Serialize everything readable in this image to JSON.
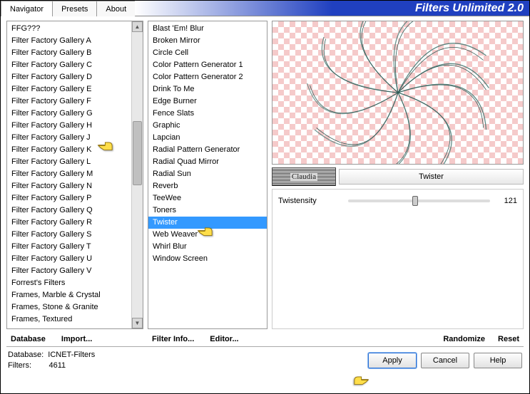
{
  "app_title": "Filters Unlimited 2.0",
  "tabs": [
    {
      "label": "Navigator",
      "active": true
    },
    {
      "label": "Presets",
      "active": false
    },
    {
      "label": "About",
      "active": false
    }
  ],
  "categories": [
    "FFG???",
    "Filter Factory Gallery A",
    "Filter Factory Gallery B",
    "Filter Factory Gallery C",
    "Filter Factory Gallery D",
    "Filter Factory Gallery E",
    "Filter Factory Gallery F",
    "Filter Factory Gallery G",
    "Filter Factory Gallery H",
    "Filter Factory Gallery J",
    "Filter Factory Gallery K",
    "Filter Factory Gallery L",
    "Filter Factory Gallery M",
    "Filter Factory Gallery N",
    "Filter Factory Gallery P",
    "Filter Factory Gallery Q",
    "Filter Factory Gallery R",
    "Filter Factory Gallery S",
    "Filter Factory Gallery T",
    "Filter Factory Gallery U",
    "Filter Factory Gallery V",
    "Forrest's Filters",
    "Frames, Marble & Crystal",
    "Frames, Stone & Granite",
    "Frames, Textured"
  ],
  "category_selected_index": 9,
  "filters": [
    "Blast 'Em! Blur",
    "Broken Mirror",
    "Circle Cell",
    "Color Pattern Generator 1",
    "Color Pattern Generator 2",
    "Drink To Me",
    "Edge Burner",
    "Fence Slats",
    "Graphic",
    "Lapcian",
    "Radial Pattern Generator",
    "Radial Quad Mirror",
    "Radial Sun",
    "Reverb",
    "TeeWee",
    "Toners",
    "Twister",
    "Web Weaver",
    "Whirl Blur",
    "Window Screen"
  ],
  "filter_selected_index": 16,
  "current_filter": "Twister",
  "params": [
    {
      "name": "Twistensity",
      "value": 121,
      "min": 0,
      "max": 255
    }
  ],
  "buttons": {
    "database": "Database",
    "import": "Import...",
    "filter_info": "Filter Info...",
    "editor": "Editor...",
    "randomize": "Randomize",
    "reset": "Reset",
    "apply": "Apply",
    "cancel": "Cancel",
    "help": "Help"
  },
  "status": {
    "db_label": "Database:",
    "db_value": "ICNET-Filters",
    "filters_label": "Filters:",
    "filters_value": "4611"
  }
}
